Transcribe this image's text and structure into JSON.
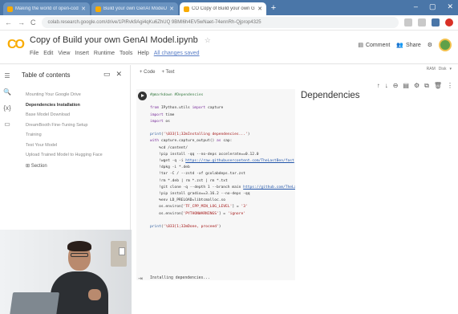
{
  "browser": {
    "tabs": [
      {
        "label": "Making the world of open-code AI"
      },
      {
        "label": "Build your own GenAI ModelJupyter"
      },
      {
        "label": "CO Copy of Build your own GenAI M"
      }
    ],
    "active_tab": 2,
    "new_tab": "+",
    "window_controls": [
      "–",
      "▢",
      "✕"
    ],
    "nav": {
      "back": "←",
      "forward": "→",
      "reload": "C"
    },
    "url": "colab.research.google.com/drive/1PlRvk9Agi4qKu6ZhUQ 9BMl6h4EV5wNaet-74ennRh-Qjprop4325"
  },
  "colab": {
    "logo": "CO",
    "title": "Copy of Build your own GenAI Model.ipynb",
    "star": "☆",
    "menu": [
      "File",
      "Edit",
      "View",
      "Insert",
      "Runtime",
      "Tools",
      "Help"
    ],
    "saved_status": "All changes saved",
    "comment_label": "Comment",
    "share_label": "Share",
    "settings_icon": "gear-icon"
  },
  "sidebar": {
    "title": "Table of contents",
    "close": "✕",
    "items": [
      {
        "label": "Mounting Your Google Drive",
        "active": false
      },
      {
        "label": "Dependencies Installation",
        "active": true
      },
      {
        "label": "Base Model Download",
        "active": false
      },
      {
        "label": "DreamBooth Fine-Tuning Setup",
        "active": false
      },
      {
        "label": "Training",
        "active": false
      },
      {
        "label": "Test Your Model",
        "active": false
      },
      {
        "label": "Upload Trained Model to Hugging Face",
        "active": false
      }
    ],
    "section_label": "Section",
    "section_prefix": "⊞"
  },
  "toolbar": {
    "add_code": "+ Code",
    "add_text": "+ Text",
    "ram_label": "RAM",
    "disk_label": "Disk"
  },
  "cell": {
    "heading": "Dependencies",
    "code_lines": [
      {
        "tokens": [
          [
            "cmt",
            "#@markdown #Dependencies"
          ]
        ]
      },
      {
        "tokens": []
      },
      {
        "tokens": [
          [
            "kw",
            "from"
          ],
          [
            "",
            " IPython.utils "
          ],
          [
            "kw",
            "import"
          ],
          [
            "",
            " capture"
          ]
        ]
      },
      {
        "tokens": [
          [
            "kw",
            "import"
          ],
          [
            "",
            " time"
          ]
        ]
      },
      {
        "tokens": [
          [
            "kw",
            "import"
          ],
          [
            "",
            " os"
          ]
        ]
      },
      {
        "tokens": []
      },
      {
        "tokens": [
          [
            "fn",
            "print"
          ],
          [
            "",
            "("
          ],
          [
            "str",
            "'\\033[1;32mInstalling dependencies...'"
          ],
          [
            "",
            ")"
          ]
        ]
      },
      {
        "tokens": [
          [
            "kw",
            "with"
          ],
          [
            "",
            " capture.capture_output() "
          ],
          [
            "kw",
            "as"
          ],
          [
            "",
            " cap:"
          ]
        ]
      },
      {
        "tokens": [
          [
            "",
            "    %cd /content/"
          ]
        ]
      },
      {
        "tokens": [
          [
            "",
            "    !pip install -qq --no-deps accelerate==0.12.0"
          ]
        ]
      },
      {
        "tokens": [
          [
            "",
            "    !wget -q -i "
          ],
          [
            "lnk",
            "https://raw.githubusercontent.com/TheLastBen/fast"
          ]
        ]
      },
      {
        "tokens": [
          [
            "",
            "    !dpkg -i *.deb"
          ]
        ]
      },
      {
        "tokens": [
          [
            "",
            "    !tar -C / --zstd -xf gcolabdeps.tar.zst"
          ]
        ]
      },
      {
        "tokens": [
          [
            "",
            "    !rm *.deb | rm *.zst | rm *.txt"
          ]
        ]
      },
      {
        "tokens": [
          [
            "",
            "    !git clone -q --depth 1 --branch main "
          ],
          [
            "lnk",
            "https://github.com/TheLa"
          ]
        ]
      },
      {
        "tokens": [
          [
            "",
            "    !pip install gradio==3.16.2 --no-deps -qq"
          ]
        ]
      },
      {
        "tokens": [
          [
            "",
            "    %env LD_PRELOAD=libtcmalloc.so"
          ]
        ]
      },
      {
        "tokens": [
          [
            "",
            "    os.environ["
          ],
          [
            "str",
            "'TF_CPP_MIN_LOG_LEVEL'"
          ],
          [
            "",
            "] = "
          ],
          [
            "str",
            "'3'"
          ]
        ]
      },
      {
        "tokens": [
          [
            "",
            "    os.environ["
          ],
          [
            "str",
            "'PYTHONWARNINGS'"
          ],
          [
            "",
            "] = "
          ],
          [
            "str",
            "'ignore'"
          ]
        ]
      },
      {
        "tokens": []
      },
      {
        "tokens": [
          [
            "fn",
            "print"
          ],
          [
            "",
            "("
          ],
          [
            "str",
            "'\\033[1;32mDone, proceed'"
          ],
          [
            "",
            ")"
          ]
        ]
      }
    ],
    "output_text": "Installing dependencies..."
  },
  "colors": {
    "chrome_tabbar": "#4a76a8",
    "colab_orange": "#f9ab00",
    "code_bg": "#f7f7f7"
  }
}
